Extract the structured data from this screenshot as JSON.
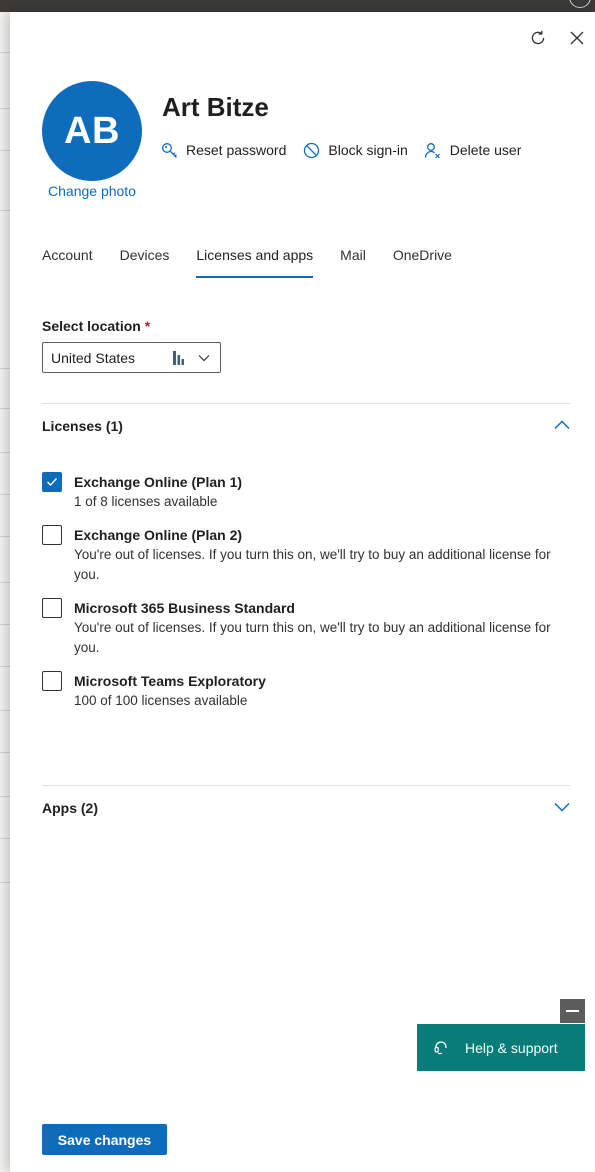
{
  "header": {
    "avatar_initials": "AB",
    "change_photo": "Change photo",
    "user_name": "Art Bitze",
    "actions": [
      {
        "label": "Reset password",
        "icon": "key-icon"
      },
      {
        "label": "Block sign-in",
        "icon": "block-icon"
      },
      {
        "label": "Delete user",
        "icon": "delete-user-icon"
      }
    ]
  },
  "window_controls": {
    "refresh_icon": "refresh-icon",
    "close_icon": "close-icon"
  },
  "tabs": [
    {
      "label": "Account",
      "active": false
    },
    {
      "label": "Devices",
      "active": false
    },
    {
      "label": "Licenses and apps",
      "active": true
    },
    {
      "label": "Mail",
      "active": false
    },
    {
      "label": "OneDrive",
      "active": false
    }
  ],
  "location": {
    "label": "Select location",
    "required_mark": "*",
    "value": "United States"
  },
  "licenses": {
    "header": "Licenses (1)",
    "expanded": true,
    "items": [
      {
        "title": "Exchange Online (Plan 1)",
        "desc": "1 of 8 licenses available",
        "checked": true
      },
      {
        "title": "Exchange Online (Plan 2)",
        "desc": "You're out of licenses. If you turn this on, we'll try to buy an additional license for you.",
        "checked": false
      },
      {
        "title": "Microsoft 365 Business Standard",
        "desc": "You're out of licenses. If you turn this on, we'll try to buy an additional license for you.",
        "checked": false
      },
      {
        "title": "Microsoft Teams Exploratory",
        "desc": "100 of 100 licenses available",
        "checked": false
      }
    ]
  },
  "apps": {
    "header": "Apps (2)",
    "expanded": false
  },
  "help": {
    "label": "Help & support"
  },
  "footer": {
    "save_label": "Save changes"
  },
  "colors": {
    "accent": "#0f6cbd",
    "help_bg": "#077c79",
    "required": "#a4262c"
  }
}
